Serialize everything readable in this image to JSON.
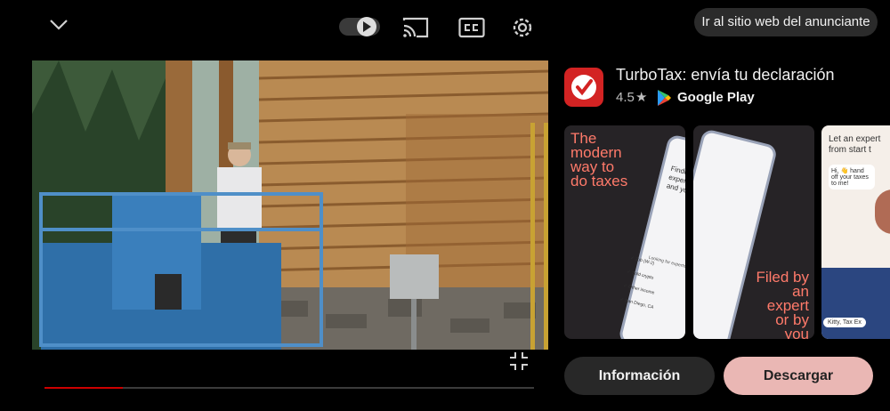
{
  "header": {
    "advertiser_site_label": "Ir al sitio web del anunciante"
  },
  "player": {
    "progress_percent": 16
  },
  "ad": {
    "app_name": "TurboTax: envía tu declaración",
    "rating": "4.5",
    "rating_star": "★",
    "store_name": "Google Play",
    "screenshots": [
      {
        "headline": [
          "The",
          "modern",
          "way to",
          "do taxes"
        ],
        "phone_heading": "Finding the right expert for you and your taxes",
        "looking_for": "Looking for expertise in:",
        "checklist": [
          "Job (W-2)",
          "Sold crypto",
          "Other income",
          "San Diego, CA"
        ]
      },
      {
        "tagline": [
          "Filed by",
          "an expert",
          "or by you"
        ]
      },
      {
        "headline": "Let an expert from start t",
        "chat": "Hi, 👋 hand off your taxes to me!",
        "caption": "Kitty, Tax Ex"
      }
    ],
    "info_label": "Información",
    "download_label": "Descargar"
  },
  "colors": {
    "accent_red": "#d32323",
    "download_bg": "#eab7b4",
    "progress": "#cc0000"
  }
}
